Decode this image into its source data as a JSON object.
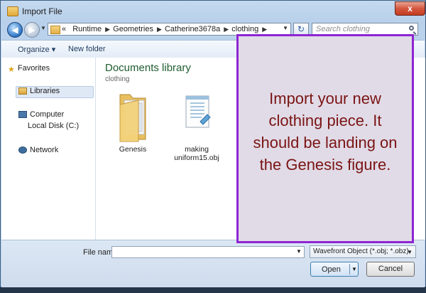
{
  "window": {
    "title": "Import File",
    "close_glyph": "x"
  },
  "nav": {
    "back_glyph": "◀",
    "forward_glyph": "▶",
    "crumb_prefix": "«",
    "breadcrumbs": [
      "Runtime",
      "Geometries",
      "Catherine3678a",
      "clothing"
    ],
    "refresh_glyph": "↻",
    "search_placeholder": "Search clothing"
  },
  "toolbar": {
    "organize_label": "Organize ▾",
    "new_folder_label": "New folder"
  },
  "sidebar": {
    "favorites": "Favorites",
    "libraries": "Libraries",
    "computer": "Computer",
    "local_disk": "Local Disk (C:)",
    "network": "Network"
  },
  "library": {
    "title": "Documents library",
    "subtitle": "clothing",
    "files": [
      {
        "name": "Genesis",
        "icon": "folder-icon"
      },
      {
        "name": "making uniform15.obj",
        "icon": "obj-file-icon"
      }
    ]
  },
  "overlay": {
    "text": "Import your new clothing piece. It should be landing on the Genesis figure."
  },
  "bottom": {
    "file_name_label": "File name:",
    "file_name_value": "",
    "file_type": "Wavefront Object (*.obj; *.obz)",
    "open_label": "Open",
    "cancel_label": "Cancel"
  },
  "colors": {
    "overlay_border": "#8f25d3",
    "overlay_text": "#7a1414",
    "library_title": "#1f5c2e"
  }
}
